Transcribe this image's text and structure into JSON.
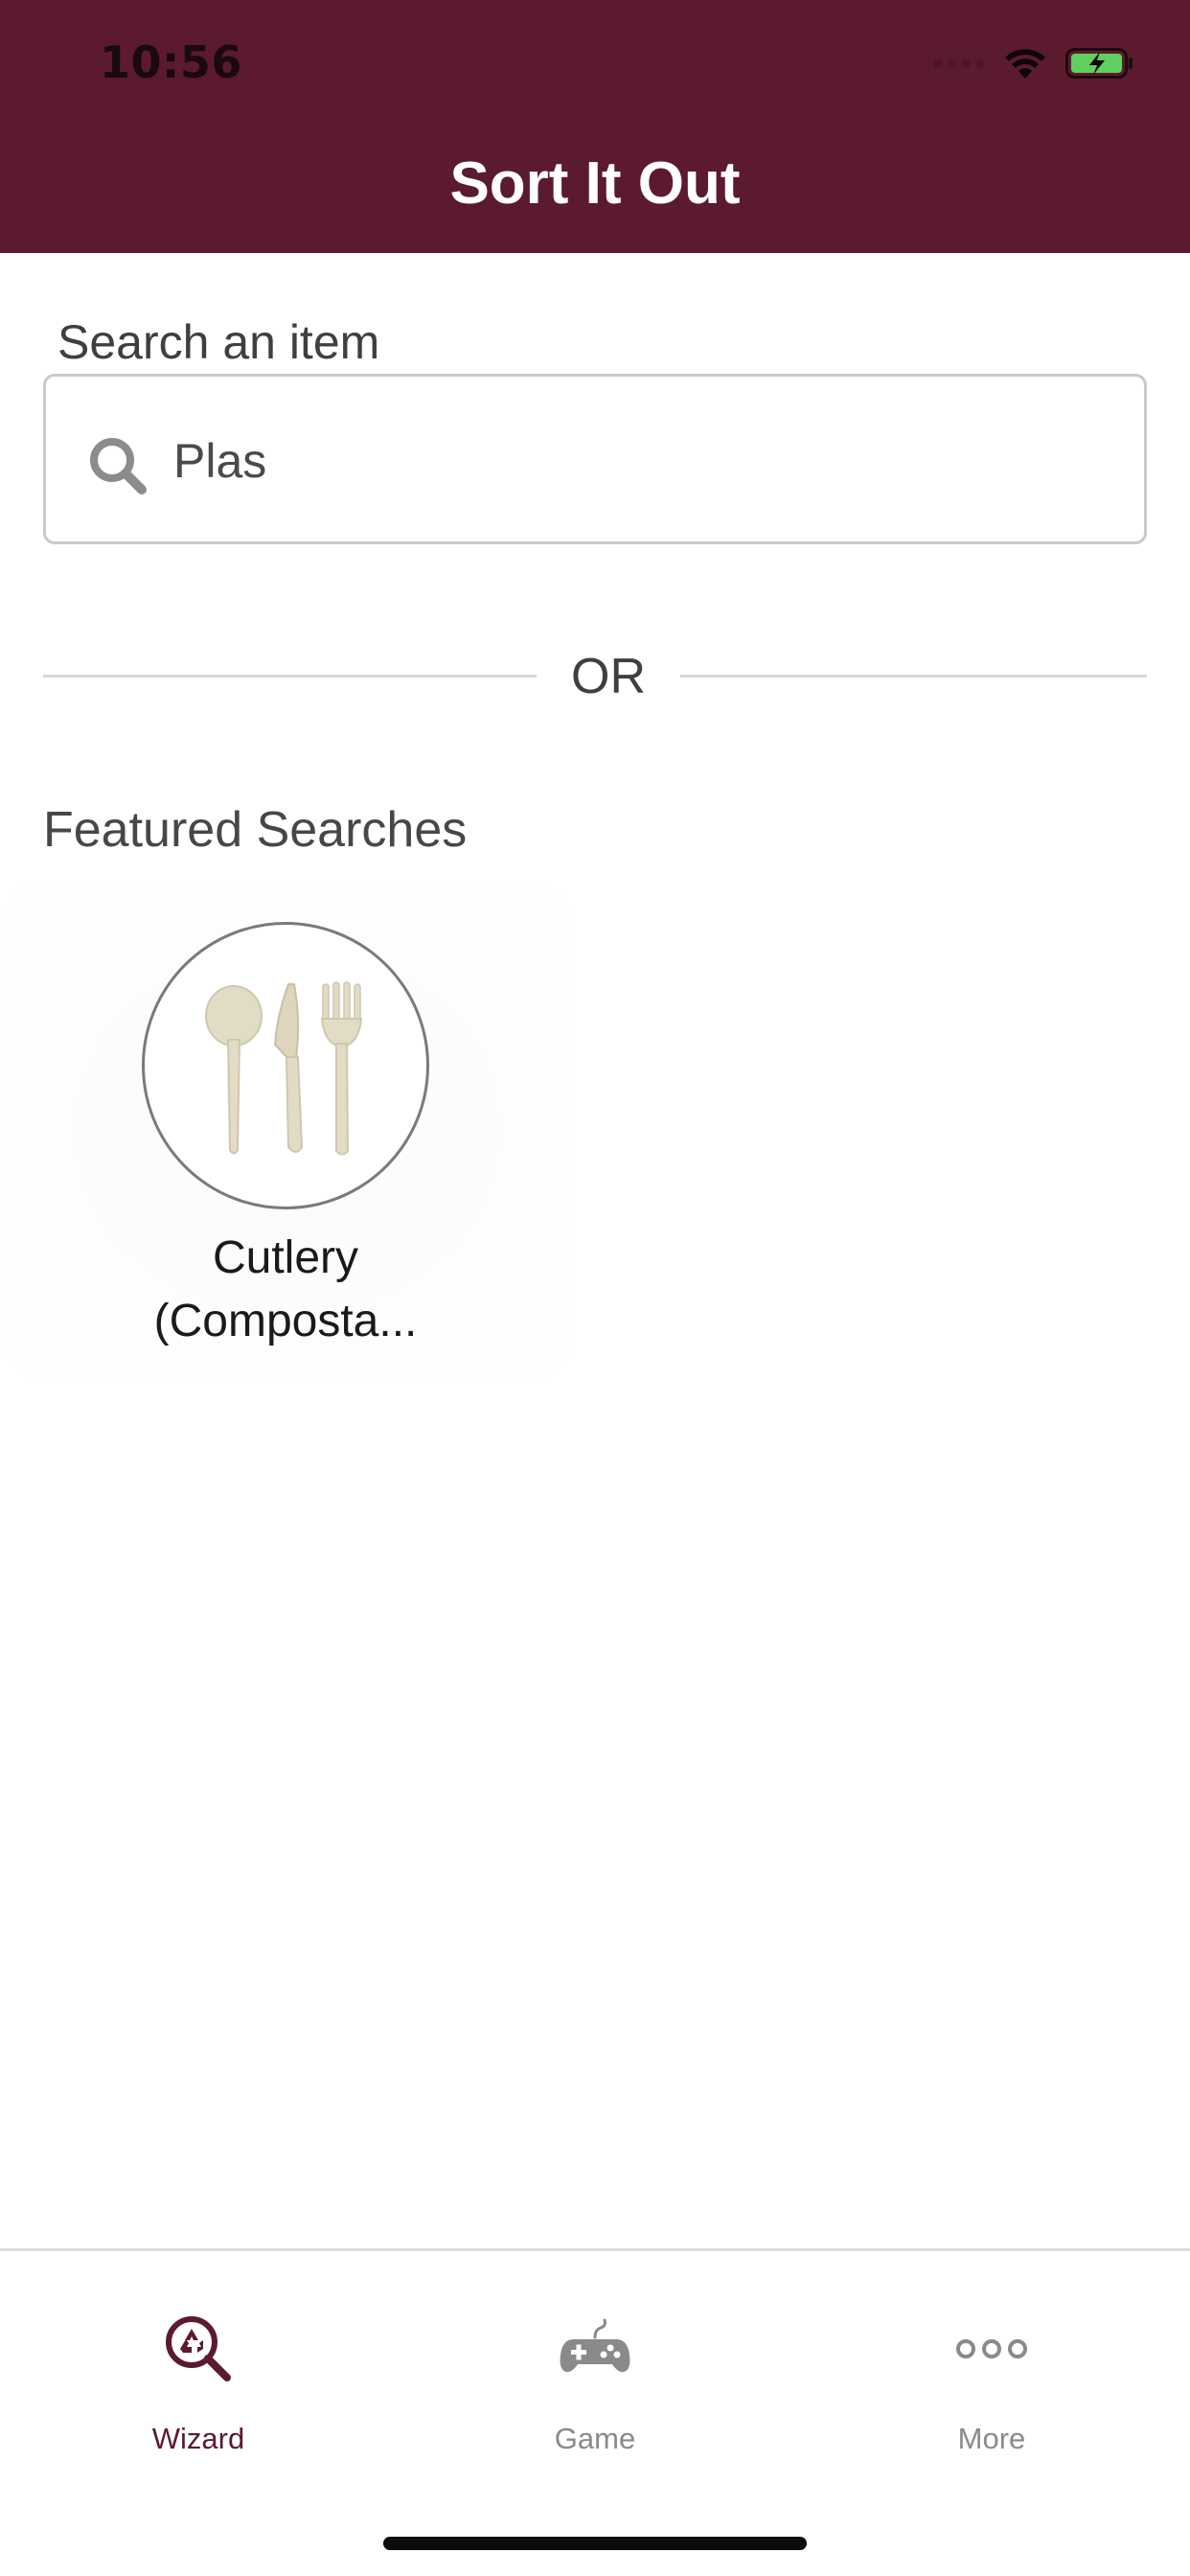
{
  "status_bar": {
    "time": "10:56"
  },
  "header": {
    "title": "Sort It Out",
    "background_color": "#5c1a2e"
  },
  "search": {
    "label": "Search an item",
    "value": "Plas",
    "icon": "search-icon"
  },
  "divider": {
    "text": "OR"
  },
  "featured": {
    "title": "Featured Searches",
    "items": [
      {
        "label_line1": "Cutlery",
        "label_line2": "(Composta...",
        "icon": "cutlery-icon"
      }
    ]
  },
  "tabbar": {
    "tabs": [
      {
        "label": "Wizard",
        "icon": "recycle-search-icon",
        "active": true
      },
      {
        "label": "Game",
        "icon": "gamepad-icon",
        "active": false
      },
      {
        "label": "More",
        "icon": "more-dots-icon",
        "active": false
      }
    ],
    "active_color": "#5c1a2e",
    "inactive_color": "#8a8a8a"
  }
}
